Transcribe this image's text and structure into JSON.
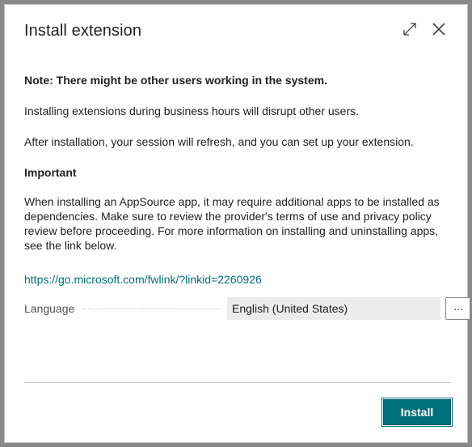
{
  "dialog": {
    "title": "Install extension",
    "expand_icon": "expand-icon",
    "close_icon": "close-icon"
  },
  "content": {
    "note": "Note: There might be other users working in the system.",
    "p1": "Installing extensions during business hours will disrupt other users.",
    "p2": "After installation, your session will refresh, and you can set up your extension.",
    "important_heading": "Important",
    "p3": "When installing an AppSource app, it may require additional apps to be installed as dependencies. Make sure to review the provider's terms of use and privacy policy review before proceeding. For more information on installing and uninstalling apps, see the link below.",
    "link": "https://go.microsoft.com/fwlink/?linkid=2260926"
  },
  "language": {
    "label": "Language",
    "value": "English (United States)",
    "more_label": "···"
  },
  "footer": {
    "install_label": "Install"
  },
  "colors": {
    "accent": "#00707a",
    "field_bg": "#ececec",
    "overlay": "#8a8a8a"
  }
}
